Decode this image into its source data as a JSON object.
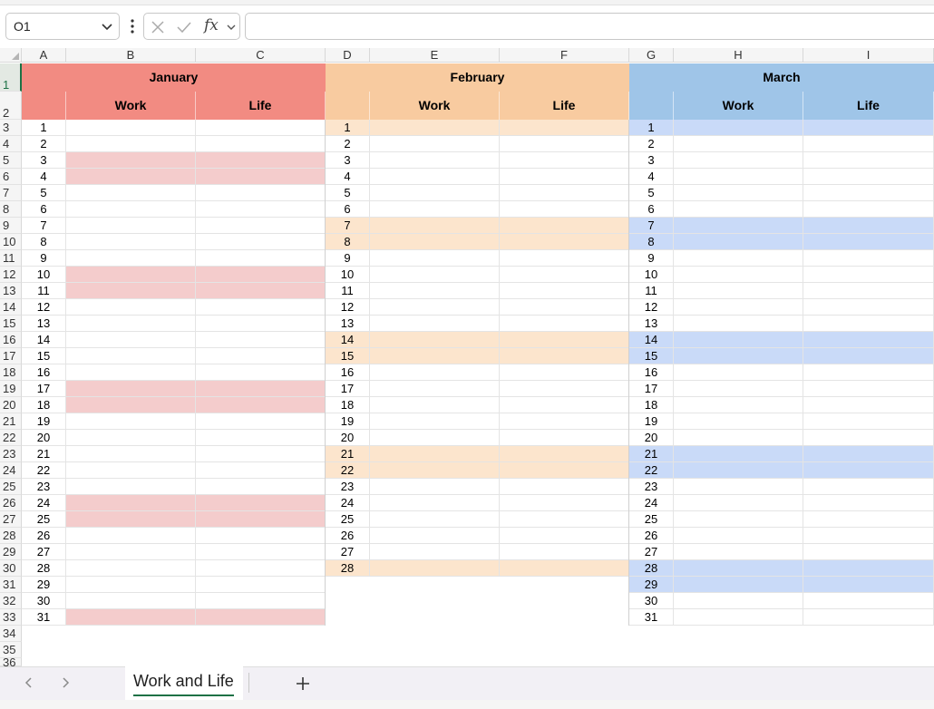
{
  "formula_bar": {
    "name_box": "O1",
    "fx_label": "fx",
    "formula": ""
  },
  "columns": [
    "A",
    "B",
    "C",
    "D",
    "E",
    "F",
    "G",
    "H",
    "I"
  ],
  "rows": [
    "1",
    "2",
    "3",
    "4",
    "5",
    "6",
    "7",
    "8",
    "9",
    "10",
    "11",
    "12",
    "13",
    "14",
    "15",
    "16",
    "17",
    "18",
    "19",
    "20",
    "21",
    "22",
    "23",
    "24",
    "25",
    "26",
    "27",
    "28",
    "29",
    "30",
    "31",
    "32",
    "33",
    "34",
    "35",
    "36"
  ],
  "selected_row": "1",
  "colors": {
    "jan_header": "#f28b82",
    "jan_stripe": "#f4cccc",
    "feb_header": "#f8cba0",
    "feb_stripe": "#fce5cd",
    "mar_header": "#9fc5e8",
    "mar_stripe": "#c9daf8",
    "accent": "#1e7145"
  },
  "months": [
    {
      "name": "January",
      "work": "Work",
      "life": "Life",
      "days": 31,
      "shaded_days": [
        3,
        4,
        10,
        11,
        17,
        18,
        24,
        25,
        31
      ]
    },
    {
      "name": "February",
      "work": "Work",
      "life": "Life",
      "days": 28,
      "shaded_days": [
        1,
        7,
        8,
        14,
        15,
        21,
        22,
        28
      ]
    },
    {
      "name": "March",
      "work": "Work",
      "life": "Life",
      "days": 31,
      "shaded_days": [
        1,
        7,
        8,
        14,
        15,
        21,
        22,
        28,
        29
      ]
    }
  ],
  "sheet_tabs": [
    {
      "label": "Work and Life",
      "active": true
    }
  ],
  "icons": {
    "name_box_dropdown": "chevron-down-icon",
    "more": "more-vertical-icon",
    "cancel": "close-icon",
    "enter": "check-icon",
    "function": "fx-icon",
    "prev_sheet": "chevron-left-icon",
    "next_sheet": "chevron-right-icon",
    "add_sheet": "plus-icon"
  }
}
